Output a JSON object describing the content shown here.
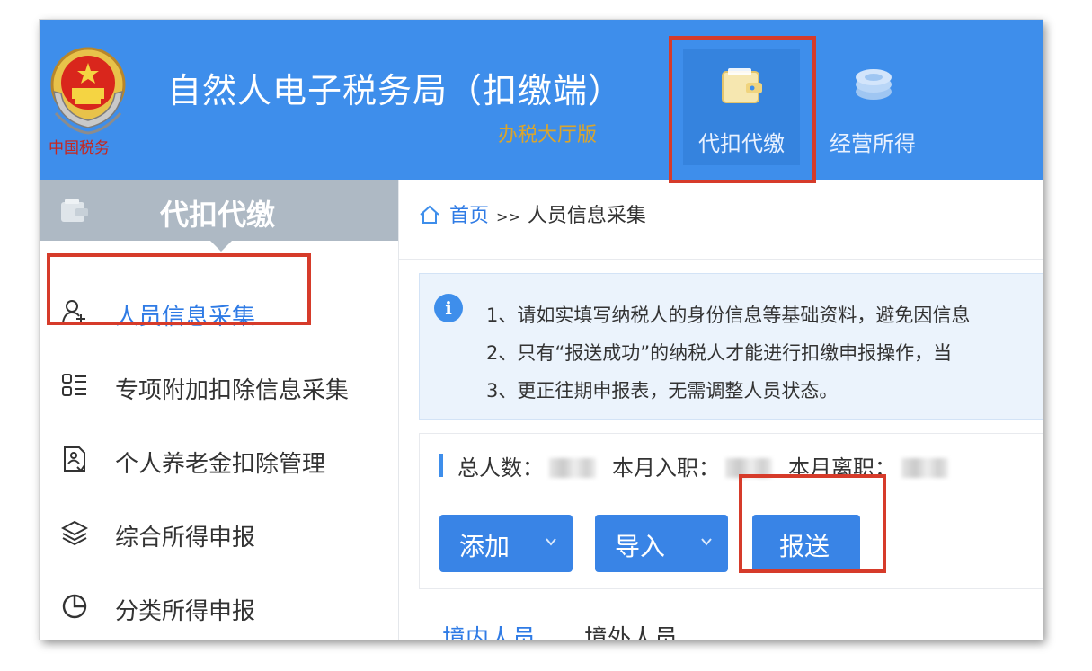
{
  "header": {
    "app_title": "自然人电子税务局（扣缴端）",
    "app_subtitle": "办税大厅版",
    "emblem_caption": "中国税务",
    "nav": [
      {
        "label": "代扣代缴",
        "icon": "wallet-icon",
        "active": true
      },
      {
        "label": "经营所得",
        "icon": "coins-icon",
        "active": false
      }
    ]
  },
  "sidebar": {
    "title": "代扣代缴",
    "items": [
      {
        "label": "人员信息采集",
        "icon": "person-add-icon",
        "active": true
      },
      {
        "label": "专项附加扣除信息采集",
        "icon": "list-icon",
        "active": false
      },
      {
        "label": "个人养老金扣除管理",
        "icon": "document-person-icon",
        "active": false
      },
      {
        "label": "综合所得申报",
        "icon": "layers-icon",
        "active": false
      },
      {
        "label": "分类所得申报",
        "icon": "pie-chart-icon",
        "active": false
      }
    ]
  },
  "breadcrumb": {
    "home": "首页",
    "separator": ">>",
    "current": "人员信息采集"
  },
  "notice": {
    "lines": [
      "1、请如实填写纳税人的身份信息等基础资料，避免因信息",
      "2、只有“报送成功”的纳税人才能进行扣缴申报操作，当",
      "3、更正往期申报表，无需调整人员状态。"
    ]
  },
  "stats": {
    "total_label": "总人数：",
    "joined_label": "本月入职：",
    "left_label": "本月离职："
  },
  "buttons": {
    "add": "添加",
    "import": "导入",
    "submit": "报送"
  },
  "tabs": [
    {
      "label": "境内人员",
      "active": true
    },
    {
      "label": "境外人员",
      "active": false
    }
  ],
  "colors": {
    "header_bg": "#3e8eeb",
    "accent": "#2f7be5",
    "highlight": "#d63b2a",
    "subtitle": "#d9a52e"
  }
}
